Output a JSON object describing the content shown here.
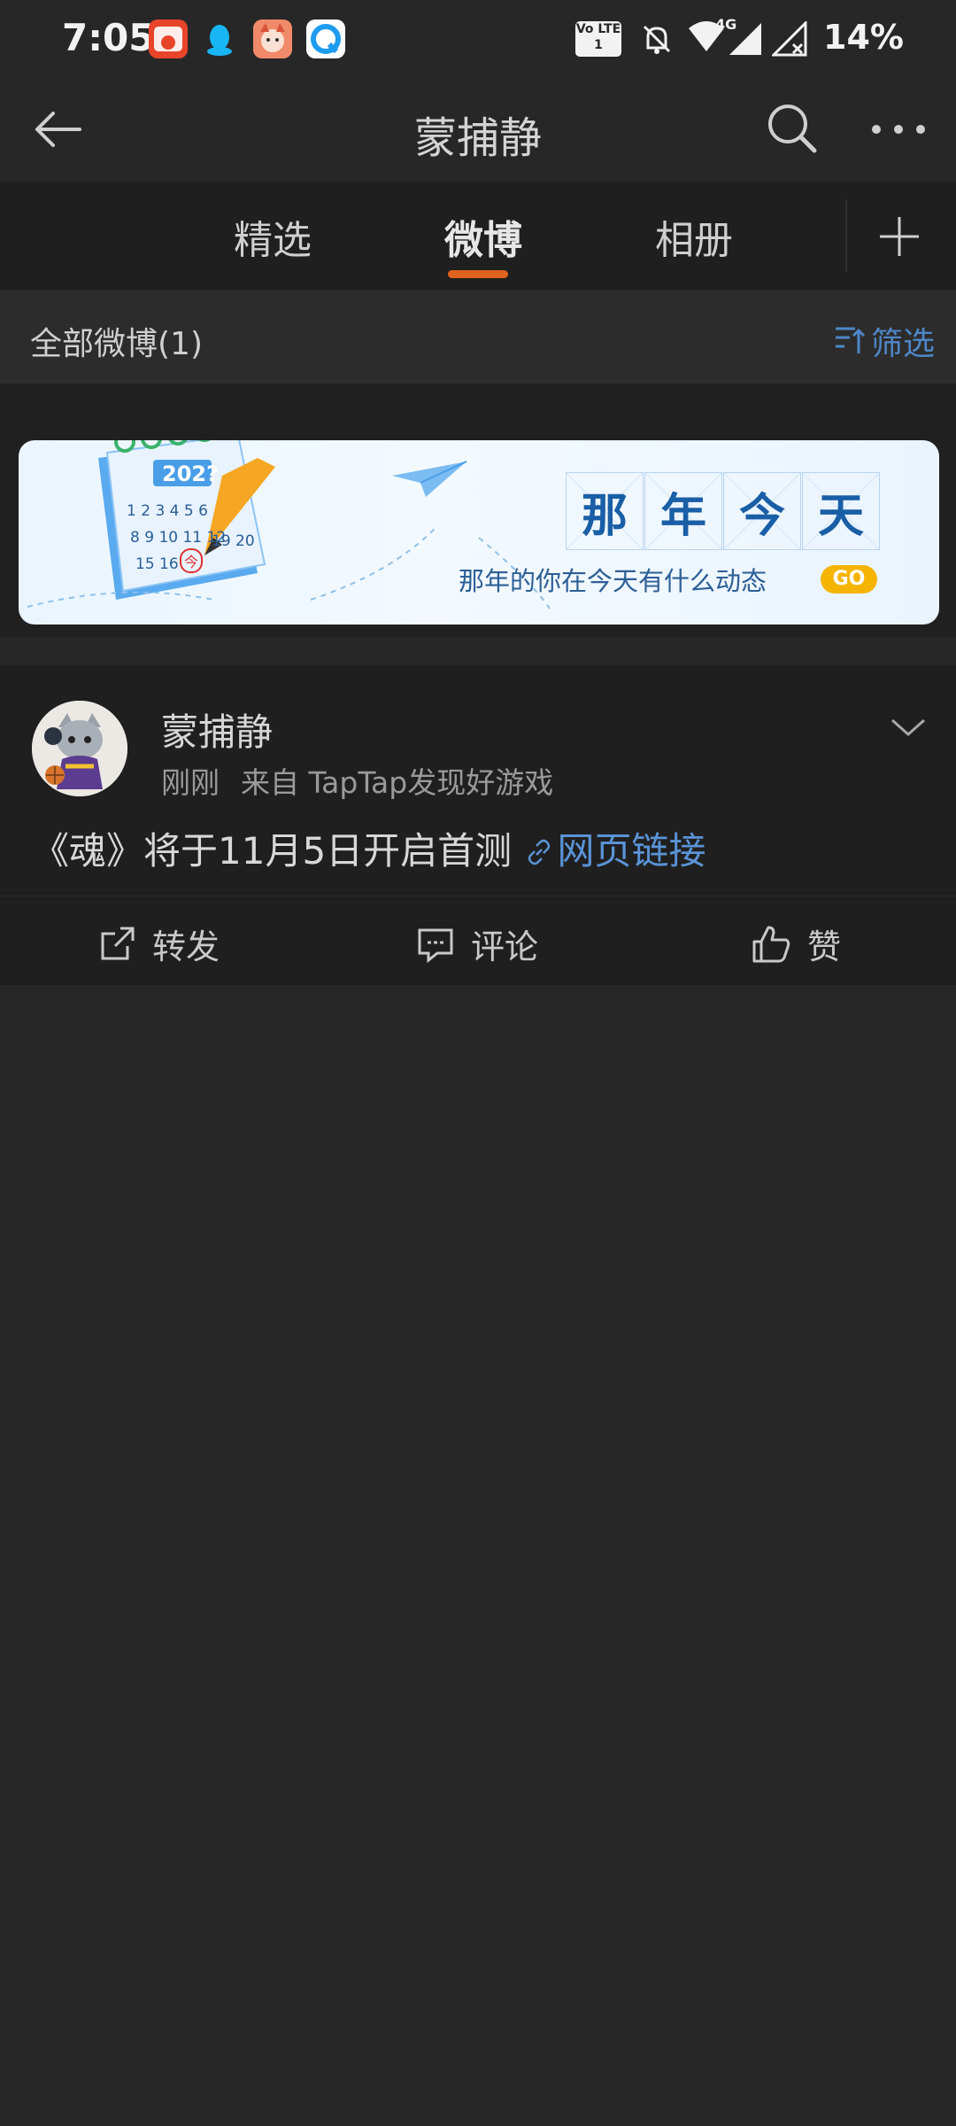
{
  "status_bar": {
    "time": "7:05",
    "battery": "14%",
    "network": "4G",
    "volte": "Vo LTE 1",
    "icons": [
      "ecommerce-app-icon",
      "qq-penguin-icon",
      "anime-app-icon",
      "qq-browser-icon",
      "volte-icon",
      "mute-bell-icon",
      "wifi-icon",
      "signal-icon",
      "no-signal-icon"
    ]
  },
  "header": {
    "title": "蒙捕静",
    "back_icon": "back-arrow-icon",
    "search_icon": "search-icon",
    "more_icon": "more-icon"
  },
  "tabs": {
    "items": [
      {
        "label": "精选"
      },
      {
        "label": "微博"
      },
      {
        "label": "相册"
      }
    ],
    "active_index": 1,
    "add_icon": "plus-icon",
    "accent": "#e0621f"
  },
  "filter_row": {
    "all_label": "全部微博(1)",
    "filter_label": "筛选",
    "filter_icon": "sort-filter-icon",
    "accent": "#4e86c6"
  },
  "banner": {
    "title_chars": [
      "那",
      "年",
      "今",
      "天"
    ],
    "subtitle": "那年的你在今天有什么动态",
    "go_label": "GO",
    "calendar_year": "202?",
    "calendar_numbers": "1 2 3 4 5 6",
    "calendar_numbers_2": "8 9 10 11 12",
    "calendar_numbers_3": "15 16",
    "calendar_today": "今",
    "calendar_20": "19 20"
  },
  "post": {
    "author": "蒙捕静",
    "time": "刚刚",
    "source": "来自 TapTap发现好游戏",
    "text": "《魂》将于11月5日开启首测 ",
    "link_label": "网页链接",
    "link_color": "#5a93d6"
  },
  "actions": {
    "repost": "转发",
    "comment": "评论",
    "like": "赞"
  }
}
